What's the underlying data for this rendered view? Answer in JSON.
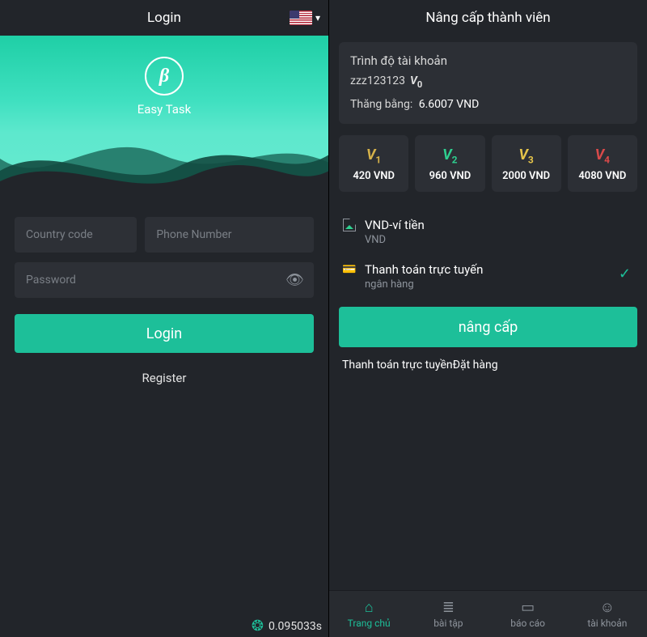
{
  "left": {
    "header_title": "Login",
    "language_flag": "us",
    "app_name": "Easy Task",
    "inputs": {
      "country_code_placeholder": "Country code",
      "phone_placeholder": "Phone Number",
      "password_placeholder": "Password"
    },
    "login_label": "Login",
    "register_label": "Register",
    "timer": "0.095033s"
  },
  "right": {
    "header_title": "Nâng cấp thành viên",
    "account": {
      "level_label": "Trình độ tài khoản",
      "username": "zzz123123",
      "level_badge": "V",
      "level_num": "0",
      "balance_label": "Thăng bằng:",
      "balance_value": "6.6007 VND"
    },
    "tiers": [
      {
        "badge": "V",
        "num": "1",
        "price": "420 VND",
        "color": "c1"
      },
      {
        "badge": "V",
        "num": "2",
        "price": "960 VND",
        "color": "c2"
      },
      {
        "badge": "V",
        "num": "3",
        "price": "2000 VND",
        "color": "c3"
      },
      {
        "badge": "V",
        "num": "4",
        "price": "4080 VND",
        "color": "c4"
      }
    ],
    "payments": [
      {
        "title": "VND-ví tiền",
        "subtitle": "VND",
        "icon": "broken-image-icon",
        "selected": false
      },
      {
        "title": "Thanh toán trực tuyến",
        "subtitle": "ngân hàng",
        "icon": "credit-card-icon",
        "selected": true
      }
    ],
    "upgrade_label": "nâng cấp",
    "note": "Thanh toán trực tuyềnĐặt hàng",
    "tabs": [
      {
        "label": "Trang chủ",
        "icon": "⌂",
        "active": true
      },
      {
        "label": "bài tập",
        "icon": "≣",
        "active": false
      },
      {
        "label": "báo cáo",
        "icon": "▭",
        "active": false
      },
      {
        "label": "tài khoản",
        "icon": "☺",
        "active": false
      }
    ]
  }
}
